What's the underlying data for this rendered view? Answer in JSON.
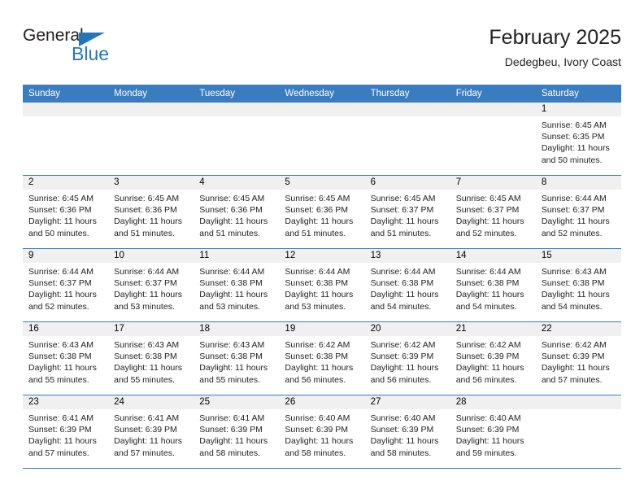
{
  "brand": {
    "name_part1": "General",
    "name_part2": "Blue",
    "triangle_color": "#2277bb"
  },
  "header": {
    "title": "February 2025",
    "subtitle": "Dedegbeu, Ivory Coast"
  },
  "theme": {
    "header_blue": "#3a7cc0",
    "daynum_gray": "#f0f0f0",
    "text_dark": "#222222"
  },
  "weekdays": [
    "Sunday",
    "Monday",
    "Tuesday",
    "Wednesday",
    "Thursday",
    "Friday",
    "Saturday"
  ],
  "labels": {
    "sunrise": "Sunrise:",
    "sunset": "Sunset:",
    "daylight": "Daylight:"
  },
  "weeks": [
    [
      {
        "day": "",
        "empty": true
      },
      {
        "day": "",
        "empty": true
      },
      {
        "day": "",
        "empty": true
      },
      {
        "day": "",
        "empty": true
      },
      {
        "day": "",
        "empty": true
      },
      {
        "day": "",
        "empty": true
      },
      {
        "day": "1",
        "sunrise": "Sunrise: 6:45 AM",
        "sunset": "Sunset: 6:35 PM",
        "daylight": "Daylight: 11 hours and 50 minutes."
      }
    ],
    [
      {
        "day": "2",
        "sunrise": "Sunrise: 6:45 AM",
        "sunset": "Sunset: 6:36 PM",
        "daylight": "Daylight: 11 hours and 50 minutes."
      },
      {
        "day": "3",
        "sunrise": "Sunrise: 6:45 AM",
        "sunset": "Sunset: 6:36 PM",
        "daylight": "Daylight: 11 hours and 51 minutes."
      },
      {
        "day": "4",
        "sunrise": "Sunrise: 6:45 AM",
        "sunset": "Sunset: 6:36 PM",
        "daylight": "Daylight: 11 hours and 51 minutes."
      },
      {
        "day": "5",
        "sunrise": "Sunrise: 6:45 AM",
        "sunset": "Sunset: 6:36 PM",
        "daylight": "Daylight: 11 hours and 51 minutes."
      },
      {
        "day": "6",
        "sunrise": "Sunrise: 6:45 AM",
        "sunset": "Sunset: 6:37 PM",
        "daylight": "Daylight: 11 hours and 51 minutes."
      },
      {
        "day": "7",
        "sunrise": "Sunrise: 6:45 AM",
        "sunset": "Sunset: 6:37 PM",
        "daylight": "Daylight: 11 hours and 52 minutes."
      },
      {
        "day": "8",
        "sunrise": "Sunrise: 6:44 AM",
        "sunset": "Sunset: 6:37 PM",
        "daylight": "Daylight: 11 hours and 52 minutes."
      }
    ],
    [
      {
        "day": "9",
        "sunrise": "Sunrise: 6:44 AM",
        "sunset": "Sunset: 6:37 PM",
        "daylight": "Daylight: 11 hours and 52 minutes."
      },
      {
        "day": "10",
        "sunrise": "Sunrise: 6:44 AM",
        "sunset": "Sunset: 6:37 PM",
        "daylight": "Daylight: 11 hours and 53 minutes."
      },
      {
        "day": "11",
        "sunrise": "Sunrise: 6:44 AM",
        "sunset": "Sunset: 6:38 PM",
        "daylight": "Daylight: 11 hours and 53 minutes."
      },
      {
        "day": "12",
        "sunrise": "Sunrise: 6:44 AM",
        "sunset": "Sunset: 6:38 PM",
        "daylight": "Daylight: 11 hours and 53 minutes."
      },
      {
        "day": "13",
        "sunrise": "Sunrise: 6:44 AM",
        "sunset": "Sunset: 6:38 PM",
        "daylight": "Daylight: 11 hours and 54 minutes."
      },
      {
        "day": "14",
        "sunrise": "Sunrise: 6:44 AM",
        "sunset": "Sunset: 6:38 PM",
        "daylight": "Daylight: 11 hours and 54 minutes."
      },
      {
        "day": "15",
        "sunrise": "Sunrise: 6:43 AM",
        "sunset": "Sunset: 6:38 PM",
        "daylight": "Daylight: 11 hours and 54 minutes."
      }
    ],
    [
      {
        "day": "16",
        "sunrise": "Sunrise: 6:43 AM",
        "sunset": "Sunset: 6:38 PM",
        "daylight": "Daylight: 11 hours and 55 minutes."
      },
      {
        "day": "17",
        "sunrise": "Sunrise: 6:43 AM",
        "sunset": "Sunset: 6:38 PM",
        "daylight": "Daylight: 11 hours and 55 minutes."
      },
      {
        "day": "18",
        "sunrise": "Sunrise: 6:43 AM",
        "sunset": "Sunset: 6:38 PM",
        "daylight": "Daylight: 11 hours and 55 minutes."
      },
      {
        "day": "19",
        "sunrise": "Sunrise: 6:42 AM",
        "sunset": "Sunset: 6:38 PM",
        "daylight": "Daylight: 11 hours and 56 minutes."
      },
      {
        "day": "20",
        "sunrise": "Sunrise: 6:42 AM",
        "sunset": "Sunset: 6:39 PM",
        "daylight": "Daylight: 11 hours and 56 minutes."
      },
      {
        "day": "21",
        "sunrise": "Sunrise: 6:42 AM",
        "sunset": "Sunset: 6:39 PM",
        "daylight": "Daylight: 11 hours and 56 minutes."
      },
      {
        "day": "22",
        "sunrise": "Sunrise: 6:42 AM",
        "sunset": "Sunset: 6:39 PM",
        "daylight": "Daylight: 11 hours and 57 minutes."
      }
    ],
    [
      {
        "day": "23",
        "sunrise": "Sunrise: 6:41 AM",
        "sunset": "Sunset: 6:39 PM",
        "daylight": "Daylight: 11 hours and 57 minutes."
      },
      {
        "day": "24",
        "sunrise": "Sunrise: 6:41 AM",
        "sunset": "Sunset: 6:39 PM",
        "daylight": "Daylight: 11 hours and 57 minutes."
      },
      {
        "day": "25",
        "sunrise": "Sunrise: 6:41 AM",
        "sunset": "Sunset: 6:39 PM",
        "daylight": "Daylight: 11 hours and 58 minutes."
      },
      {
        "day": "26",
        "sunrise": "Sunrise: 6:40 AM",
        "sunset": "Sunset: 6:39 PM",
        "daylight": "Daylight: 11 hours and 58 minutes."
      },
      {
        "day": "27",
        "sunrise": "Sunrise: 6:40 AM",
        "sunset": "Sunset: 6:39 PM",
        "daylight": "Daylight: 11 hours and 58 minutes."
      },
      {
        "day": "28",
        "sunrise": "Sunrise: 6:40 AM",
        "sunset": "Sunset: 6:39 PM",
        "daylight": "Daylight: 11 hours and 59 minutes."
      },
      {
        "day": "",
        "empty": true
      }
    ]
  ]
}
